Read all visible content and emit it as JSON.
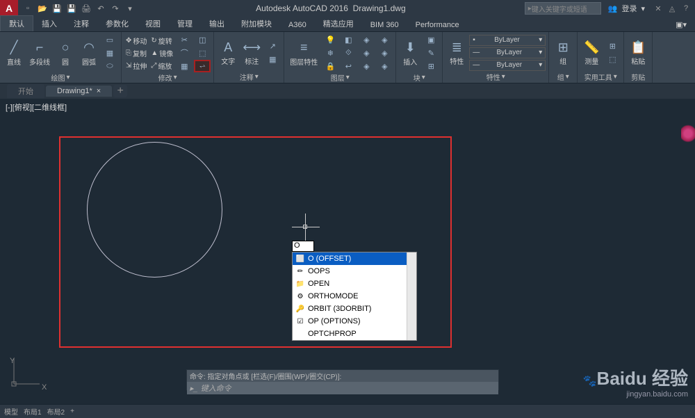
{
  "title": {
    "app": "Autodesk AutoCAD 2016",
    "doc": "Drawing1.dwg"
  },
  "search": {
    "placeholder": "键入关键字或短语"
  },
  "login": {
    "text": "登录"
  },
  "menus": [
    "默认",
    "插入",
    "注释",
    "参数化",
    "视图",
    "管理",
    "输出",
    "附加模块",
    "A360",
    "精选应用",
    "BIM 360",
    "Performance"
  ],
  "draw": {
    "line": "直线",
    "polyline": "多段线",
    "circle": "圆",
    "arc": "圆弧",
    "title": "绘图"
  },
  "modify": {
    "move": "移动",
    "copy": "复制",
    "stretch": "拉伸",
    "rotate": "旋转",
    "mirror": "镜像",
    "scale": "缩放",
    "title": "修改"
  },
  "annot": {
    "text": "文字",
    "dim": "标注",
    "title": "注释"
  },
  "layer": {
    "props": "图层特性",
    "title": "图层"
  },
  "block": {
    "insert": "插入",
    "title": "块"
  },
  "props": {
    "btn": "特性",
    "bylayer": "ByLayer",
    "title": "特性"
  },
  "group": {
    "btn": "组",
    "title": "组"
  },
  "util": {
    "measure": "测量",
    "title": "实用工具"
  },
  "clip": {
    "paste": "粘贴",
    "title": "剪贴"
  },
  "tabs": {
    "start": "开始",
    "drawing": "Drawing1*"
  },
  "viewlabel": "[-][俯视][二维线框]",
  "cmdinput": "O",
  "autocomplete": [
    {
      "icon": "⬜",
      "text": "O (OFFSET)",
      "sel": true
    },
    {
      "icon": "✏",
      "text": "OOPS"
    },
    {
      "icon": "📁",
      "text": "OPEN"
    },
    {
      "icon": "⚙",
      "text": "ORTHOMODE"
    },
    {
      "icon": "🔑",
      "text": "ORBIT (3DORBIT)"
    },
    {
      "icon": "☑",
      "text": "OP (OPTIONS)"
    },
    {
      "icon": "",
      "text": "OPTCHPROP"
    }
  ],
  "ucs": {
    "x": "X",
    "y": "Y"
  },
  "cmdhist": "命令: 指定对角点或 [栏选(F)/圈围(WP)/圈交(CP)]:",
  "cmdprompt": "键入命令",
  "status": {
    "model": "模型",
    "layout1": "布局1",
    "layout2": "布局2"
  },
  "watermark": {
    "brand": "Baidu 经验",
    "url": "jingyan.baidu.com"
  }
}
